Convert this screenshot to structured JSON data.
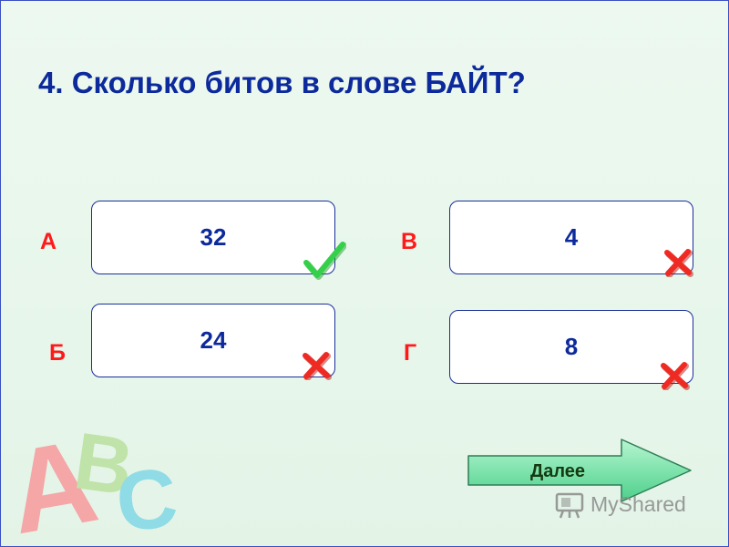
{
  "question": "4. Сколько битов в слове БАЙТ?",
  "options": [
    {
      "letter": "А",
      "value": "32",
      "correct": true
    },
    {
      "letter": "Б",
      "value": "24",
      "correct": false
    },
    {
      "letter": "В",
      "value": "4",
      "correct": false
    },
    {
      "letter": "Г",
      "value": "8",
      "correct": false
    }
  ],
  "decoration": {
    "letters": [
      "A",
      "B",
      "C"
    ]
  },
  "next_button": {
    "label": "Далее"
  },
  "watermark": {
    "text": "MyShared"
  },
  "colors": {
    "question_text": "#0d2a9c",
    "option_letter": "#ff1a1a",
    "correct_mark": "#2ecc40",
    "wrong_mark": "#e8221f",
    "next_button_fill": "#7fe3ad"
  },
  "icons": {
    "correct": "checkmark-icon",
    "wrong": "cross-icon",
    "watermark": "projector-icon"
  }
}
